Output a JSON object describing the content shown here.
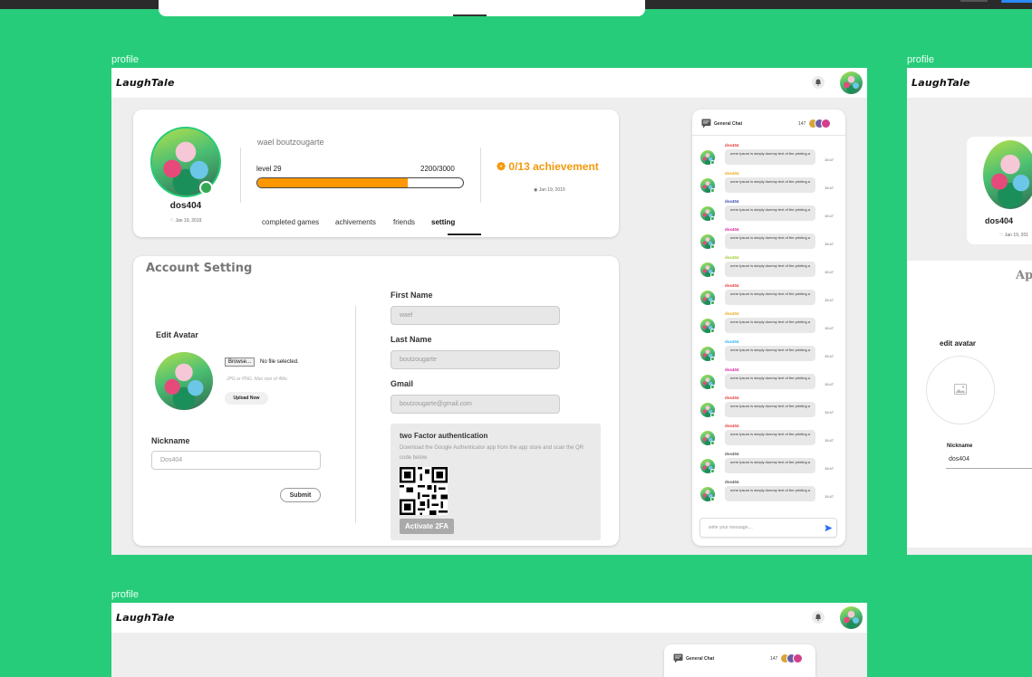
{
  "frames": {
    "main_label": "profile",
    "side_label": "profile",
    "bottom_label": "profile"
  },
  "nav": {
    "logo": "LaughTale"
  },
  "profile": {
    "login": "dos404",
    "joined": "Jan 19, 2019",
    "full_name": "wael boutzougarte",
    "level": "level 29",
    "xp": "2200/3000",
    "progress": 0.73,
    "achievements": "0/13 achievement",
    "achievement_date": "Jan 19, 2019",
    "tabs": [
      "completed games",
      "achivements",
      "friends",
      "setting"
    ]
  },
  "settings": {
    "title": "Account Setting",
    "edit_avatar": "Edit Avatar",
    "browse": "Browse...",
    "no_file": "No file selected.",
    "hint": "JPG or PNG. Max size of 4Mo",
    "upload": "Upload Now",
    "nickname_label": "Nickname",
    "nickname_value": "Dos404",
    "submit": "Submit",
    "first_name_label": "First Name",
    "first_name_value": "wael",
    "last_name_label": "Last Name",
    "last_name_value": "boutzougarte",
    "gmail_label": "Gmail",
    "gmail_value": "boutzougarte@gmail.com",
    "twofa_title": "two Factor authentication",
    "twofa_desc": "Download the Google Authenticator app from the app store and scan the QR code below",
    "activate": "Activate 2FA"
  },
  "chat": {
    "title": "General Chat",
    "count": "147",
    "placeholder": "write your message....",
    "messages": [
      {
        "user": "dos404",
        "color": "#e53935",
        "text": "orem Ipsum is simply dummy text of the printing a",
        "time": "15:47"
      },
      {
        "user": "dos404",
        "color": "#f0a818",
        "text": "orem Ipsum is simply dummy text of the printing a",
        "time": "15:47"
      },
      {
        "user": "dos404",
        "color": "#3949ab",
        "text": "orem Ipsum is simply dummy text of the printing a",
        "time": "15:47"
      },
      {
        "user": "dos404",
        "color": "#d81b9c",
        "text": "orem Ipsum is simply dummy text of the printing a",
        "time": "15:47"
      },
      {
        "user": "dos404",
        "color": "#9acd32",
        "text": "orem Ipsum is simply dummy text of the printing a",
        "time": "15:47"
      },
      {
        "user": "dos404",
        "color": "#e53935",
        "text": "orem Ipsum is simply dummy text of the printing a",
        "time": "15:47"
      },
      {
        "user": "dos404",
        "color": "#f0a818",
        "text": "orem Ipsum is simply dummy text of the printing a",
        "time": "15:47"
      },
      {
        "user": "dos404",
        "color": "#29b6f6",
        "text": "orem Ipsum is simply dummy text of the printing a",
        "time": "15:47"
      },
      {
        "user": "dos404",
        "color": "#d81b9c",
        "text": "orem Ipsum is simply dummy text of the printing a",
        "time": "15:47"
      },
      {
        "user": "dos404",
        "color": "#e53935",
        "text": "orem Ipsum is simply dummy text of the printing a",
        "time": "15:47"
      },
      {
        "user": "dos404",
        "color": "#e53935",
        "text": "orem Ipsum is simply dummy text of the printing a",
        "time": "15:47"
      },
      {
        "user": "dos404",
        "color": "#555555",
        "text": "orem Ipsum is simply dummy text of the printing a",
        "time": "15:47"
      },
      {
        "user": "dos404",
        "color": "#555555",
        "text": "orem Ipsum is simply dummy text of the printing a",
        "time": "15:47"
      }
    ]
  },
  "side": {
    "login": "dos404",
    "joined": "Jan 19, 201",
    "title": "Appe",
    "edit_avatar": "edit avatar",
    "nickname_label": "Nickname",
    "nickname_value": "dos404"
  },
  "bottom": {
    "chat_title": "General Chat",
    "chat_count": "147"
  },
  "colors": {
    "canvas": "#27CC7A",
    "accent": "#f29a0c",
    "progress": "#ff9800",
    "online": "#35a853",
    "send": "#2a6cf6"
  },
  "icons": [
    "bell-icon",
    "chat-icon",
    "send-icon",
    "image-placeholder-icon",
    "trophy-icon",
    "calendar-icon"
  ]
}
